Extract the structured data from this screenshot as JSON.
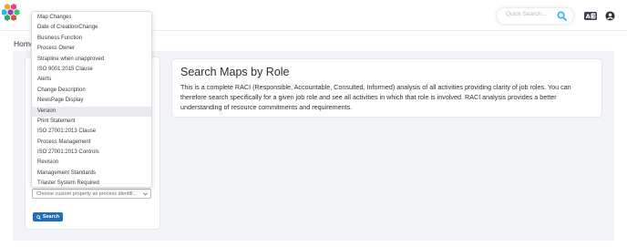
{
  "header": {
    "search_placeholder": "Quick Search...",
    "icons": [
      "logo-hexagons-icon",
      "search-icon",
      "translate-icon",
      "user-icon"
    ],
    "accent_color": "#29b6e8"
  },
  "breadcrumb": "Home",
  "dropdown": {
    "options": [
      "Map Changes",
      "Date of Creation/Change",
      "Business Function",
      "Process Owner",
      "Strapline when unapproved",
      "ISO 9001:2015 Clause",
      "Alerts",
      "Change Description",
      "NewsPage Display",
      "Version",
      "Print Statement",
      "ISO 27001:2013 Clause",
      "Process Management",
      "ISO 27001:2013 Controls",
      "Revision",
      "Management Standards",
      "Triaster System Required"
    ],
    "highlighted": "Version",
    "placeholder": "Choose custom property as process identifi..."
  },
  "search_button": {
    "label": "Search",
    "color": "#1f6fb8"
  },
  "info_card": {
    "title": "Search Maps by Role",
    "description": "This is a complete RACI (Responsible, Accountable, Consulted, Informed) analysis of all activities providing clarity of job roles. You can therefore search specifically for a given job role and see all activities in which that role is involved. RACI analysis provides a better understanding of resource commitments and requirements."
  }
}
